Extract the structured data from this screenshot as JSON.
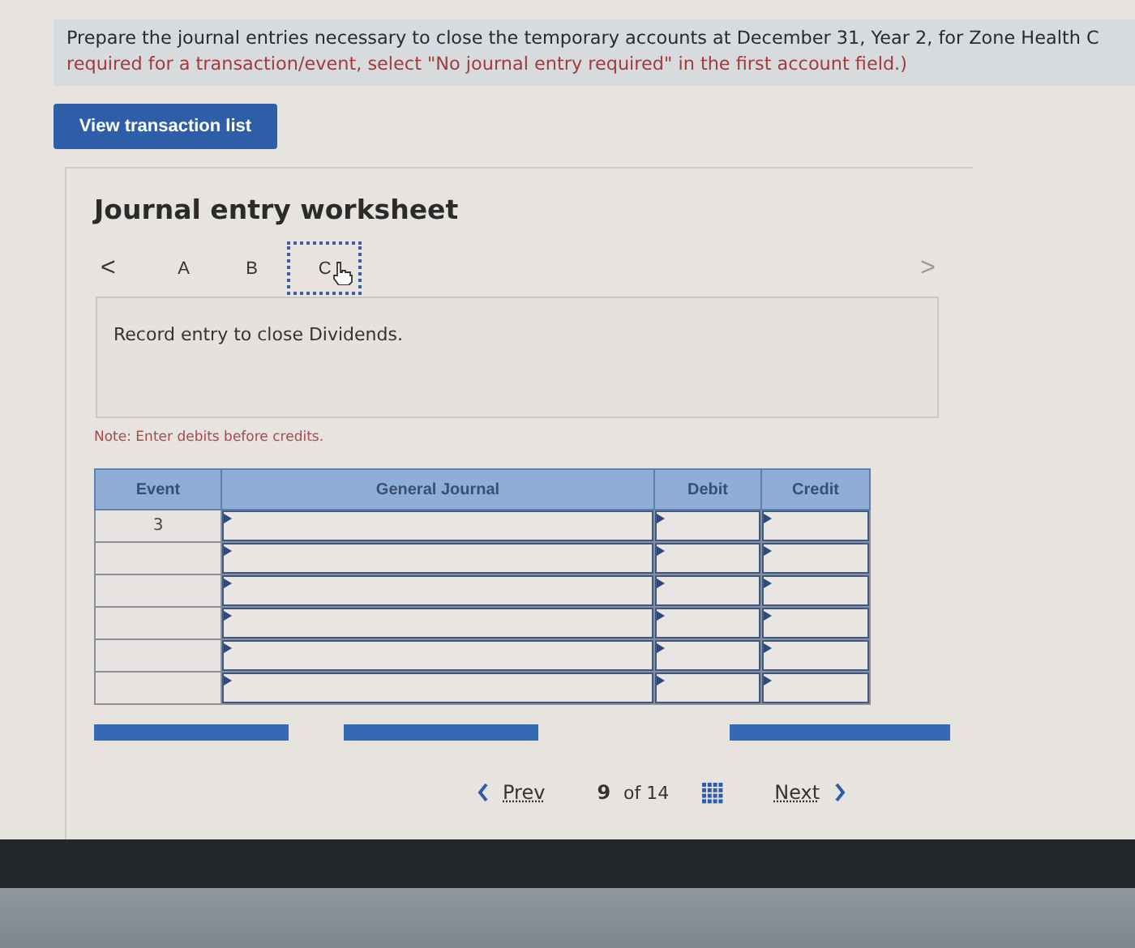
{
  "instructions": {
    "text": "Prepare the journal entries necessary to close the temporary accounts at December 31, Year 2, for Zone Health C",
    "hint": "required for a transaction/event, select \"No journal entry required\" in the first account field.)"
  },
  "view_button": "View transaction list",
  "worksheet": {
    "title": "Journal entry worksheet",
    "tabs": [
      {
        "label": "A",
        "selected": false
      },
      {
        "label": "B",
        "selected": false
      },
      {
        "label": "C",
        "selected": true
      }
    ],
    "prev_tab": "<",
    "next_tab": ">",
    "description": "Record entry to close Dividends.",
    "note": "Note: Enter debits before credits.",
    "table": {
      "columns": [
        "Event",
        "General Journal",
        "Debit",
        "Credit"
      ],
      "rows": [
        {
          "event": "3"
        },
        {},
        {},
        {},
        {},
        {}
      ]
    }
  },
  "pagination": {
    "prev": "Prev",
    "current": "9",
    "total": "of 14",
    "next": "Next"
  }
}
